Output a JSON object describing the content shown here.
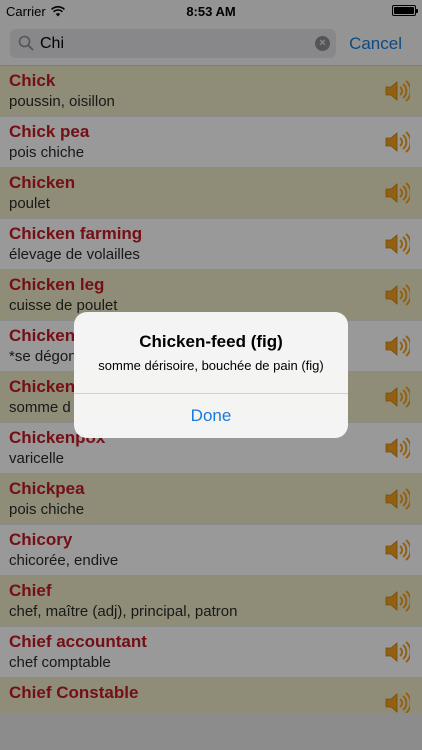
{
  "status_bar": {
    "carrier": "Carrier",
    "time": "8:53 AM"
  },
  "search": {
    "query": "Chi",
    "cancel_label": "Cancel"
  },
  "colors": {
    "accent": "#1a7ad8",
    "term": "#c21a24",
    "row_tint": "#efecc9"
  },
  "entries": [
    {
      "term": "Chick",
      "definition": "poussin, oisillon"
    },
    {
      "term": "Chick pea",
      "definition": "pois chiche"
    },
    {
      "term": "Chicken",
      "definition": "poulet"
    },
    {
      "term": "Chicken farming",
      "definition": "élevage de volailles"
    },
    {
      "term": "Chicken leg",
      "definition": "cuisse de poulet"
    },
    {
      "term": "Chicken",
      "definition": "*se dégon"
    },
    {
      "term": "Chicken",
      "definition": "somme d"
    },
    {
      "term": "Chickenpox",
      "definition": "varicelle"
    },
    {
      "term": "Chickpea",
      "definition": "pois chiche"
    },
    {
      "term": "Chicory",
      "definition": "chicorée, endive"
    },
    {
      "term": "Chief",
      "definition": "chef, maître (adj), principal, patron"
    },
    {
      "term": "Chief accountant",
      "definition": "chef comptable"
    },
    {
      "term": "Chief Constable",
      "definition": ""
    }
  ],
  "alert": {
    "title": "Chicken-feed (fig)",
    "message": "somme dérisoire, bouchée de pain (fig)",
    "button": "Done"
  }
}
